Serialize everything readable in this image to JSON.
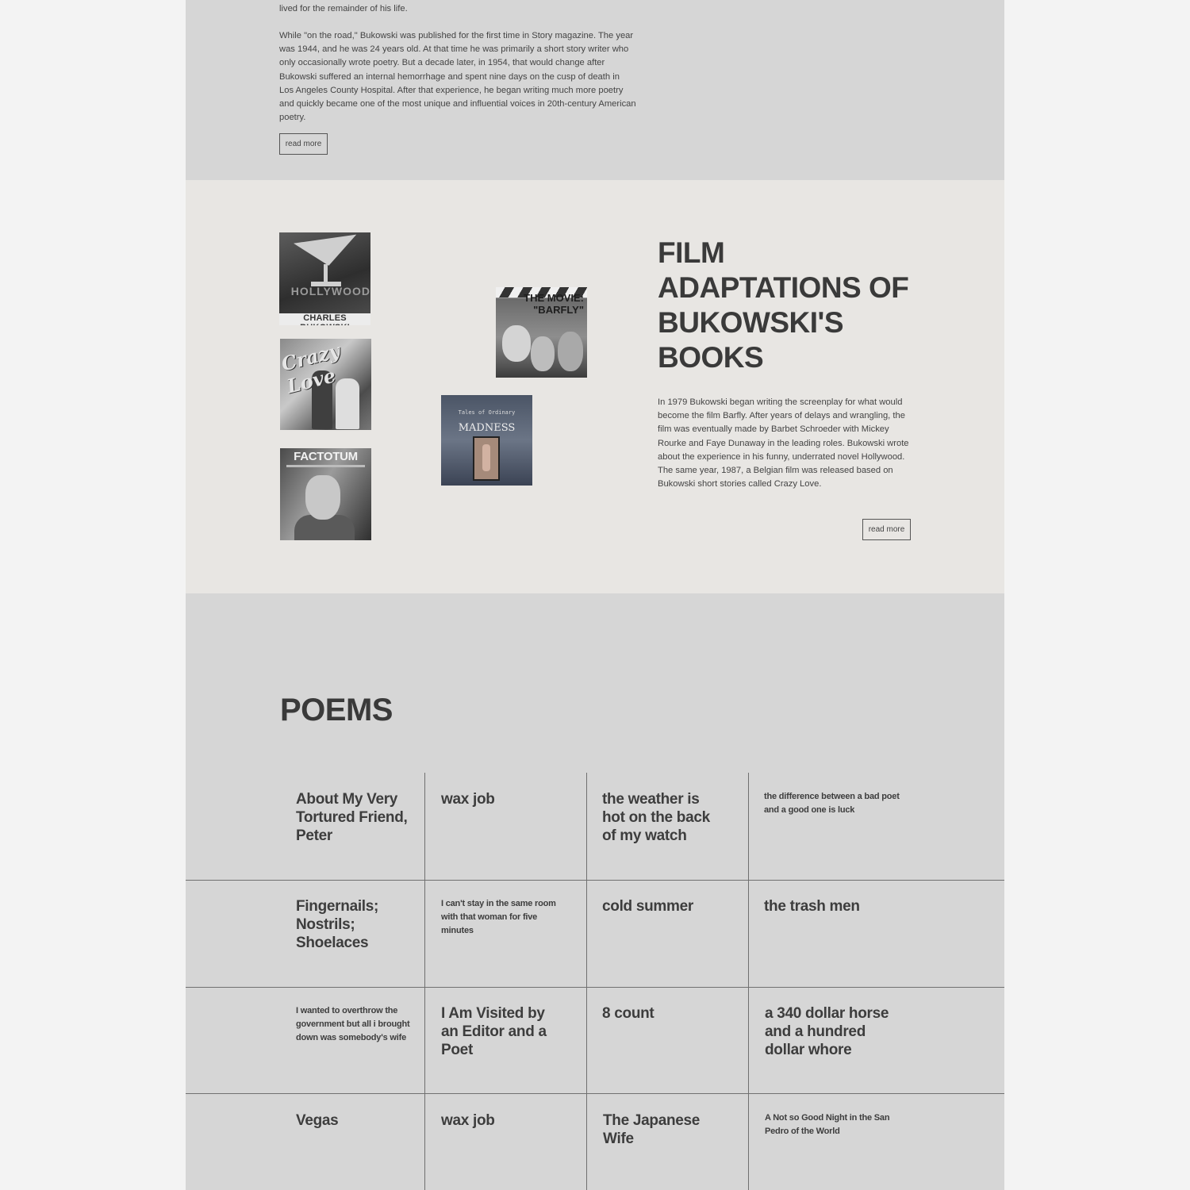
{
  "bio": {
    "line1": "lived for the remainder of his life.",
    "paragraph2": "While \"on the road,\" Bukowski was published for the first time in Story magazine. The year was 1944, and he was 24 years old. At that time he was primarily a short story writer who only occasionally wrote poetry. But a decade later, in 1954, that would change after Bukowski suffered an internal hemorrhage and spent nine days on the cusp of death in Los Angeles County Hospital. After that experience, he began writing much more poetry and quickly became one of the most unique and influential voices in 20th-century American poetry.",
    "read_more": "read more"
  },
  "film": {
    "title": "FILM ADAPTATIONS OF BUKOWSKI'S BOOKS",
    "text": "In 1979 Bukowski began writing the screenplay for what would become the film Barfly. After years of delays and wrangling, the film was eventually made by Barbet Schroeder with Mickey Rourke and Faye Dunaway in the leading roles. Bukowski wrote about the experience in his funny, underrated novel Hollywood. The same year, 1987, a Belgian film was released based on Bukowski short stories called Crazy Love.",
    "read_more": "read more",
    "posters": {
      "hollywood_word": "HOLLYWOOD",
      "hollywood_author": "CHARLES BUKOWSKI",
      "crazy_love": "Crazy Love",
      "factotum": "FACTOTUM",
      "barfly_line1": "THE MOVIE:",
      "barfly_line2": "\"BARFLY\"",
      "madness_small": "Tales of Ordinary",
      "madness_title": "MADNESS"
    }
  },
  "poems": {
    "title": "POEMS",
    "items": [
      {
        "title": "About My Very Tortured Friend, Peter"
      },
      {
        "title": "wax job"
      },
      {
        "title": "the weather is hot on the back of my watch"
      },
      {
        "title": "the difference between a bad poet and a good one is luck"
      },
      {
        "title": "Fingernails; Nostrils; Shoelaces"
      },
      {
        "title": "I can't stay in the same room with that woman for five minutes"
      },
      {
        "title": "cold summer"
      },
      {
        "title": "the trash men"
      },
      {
        "title": "I wanted to overthrow the government but all i brought down was somebody's wife"
      },
      {
        "title": "I Am Visited by an Editor and a Poet"
      },
      {
        "title": "8 count"
      },
      {
        "title": "a 340 dollar horse and a hundred dollar whore"
      },
      {
        "title": "Vegas"
      },
      {
        "title": "wax job"
      },
      {
        "title": "The Japanese Wife"
      },
      {
        "title": "A Not so Good Night in the San Pedro of the World"
      }
    ]
  }
}
